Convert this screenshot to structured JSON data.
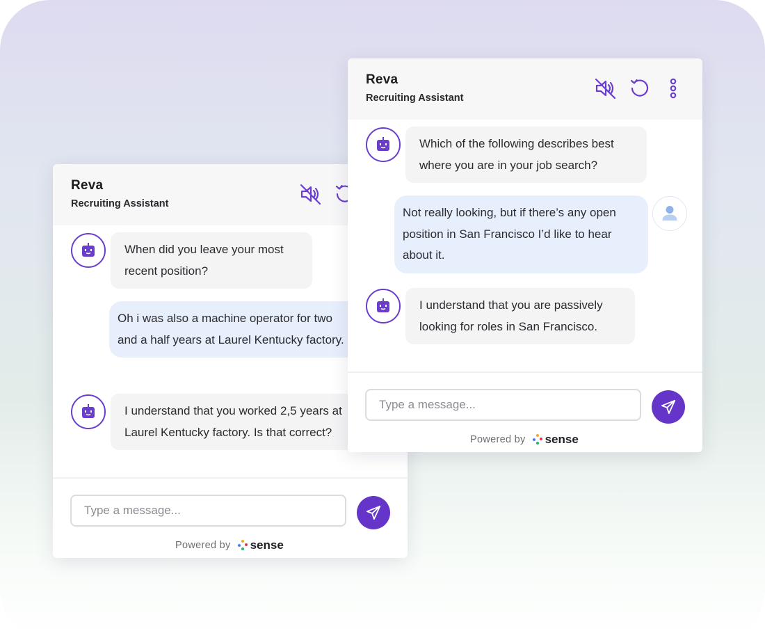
{
  "colors": {
    "accent": "#6534c9",
    "bot_bubble": "#f4f4f5",
    "user_bubble": "#e7effd",
    "header_bg": "#f7f7f8"
  },
  "back_widget": {
    "assistant_name": "Reva",
    "assistant_role": "Recruiting Assistant",
    "header_icons": [
      "sound-off-icon",
      "restart-icon"
    ],
    "messages": [
      {
        "from": "bot",
        "text": "When did you leave your most recent position?"
      },
      {
        "from": "user",
        "text": "Oh i was also a machine operator for two and a half years at Laurel Kentucky factory."
      },
      {
        "from": "bot",
        "text": "I understand that you worked  2,5 years at Laurel Kentucky factory. Is that correct?"
      }
    ],
    "input_placeholder": "Type a message...",
    "powered_by": "Powered by",
    "brand": "sense"
  },
  "front_widget": {
    "assistant_name": "Reva",
    "assistant_role": "Recruiting Assistant",
    "header_icons": [
      "sound-off-icon",
      "restart-icon",
      "more-vertical-icon"
    ],
    "messages": [
      {
        "from": "bot",
        "text": "Which of the following describes best where you are in your job search?"
      },
      {
        "from": "user",
        "text": "Not really looking, but if there’s any open position in San Francisco I’d like to hear about it."
      },
      {
        "from": "bot",
        "text": "I understand that you are passively looking for roles in San Francisco."
      }
    ],
    "input_placeholder": "Type a message...",
    "powered_by": "Powered by",
    "brand": "sense"
  }
}
